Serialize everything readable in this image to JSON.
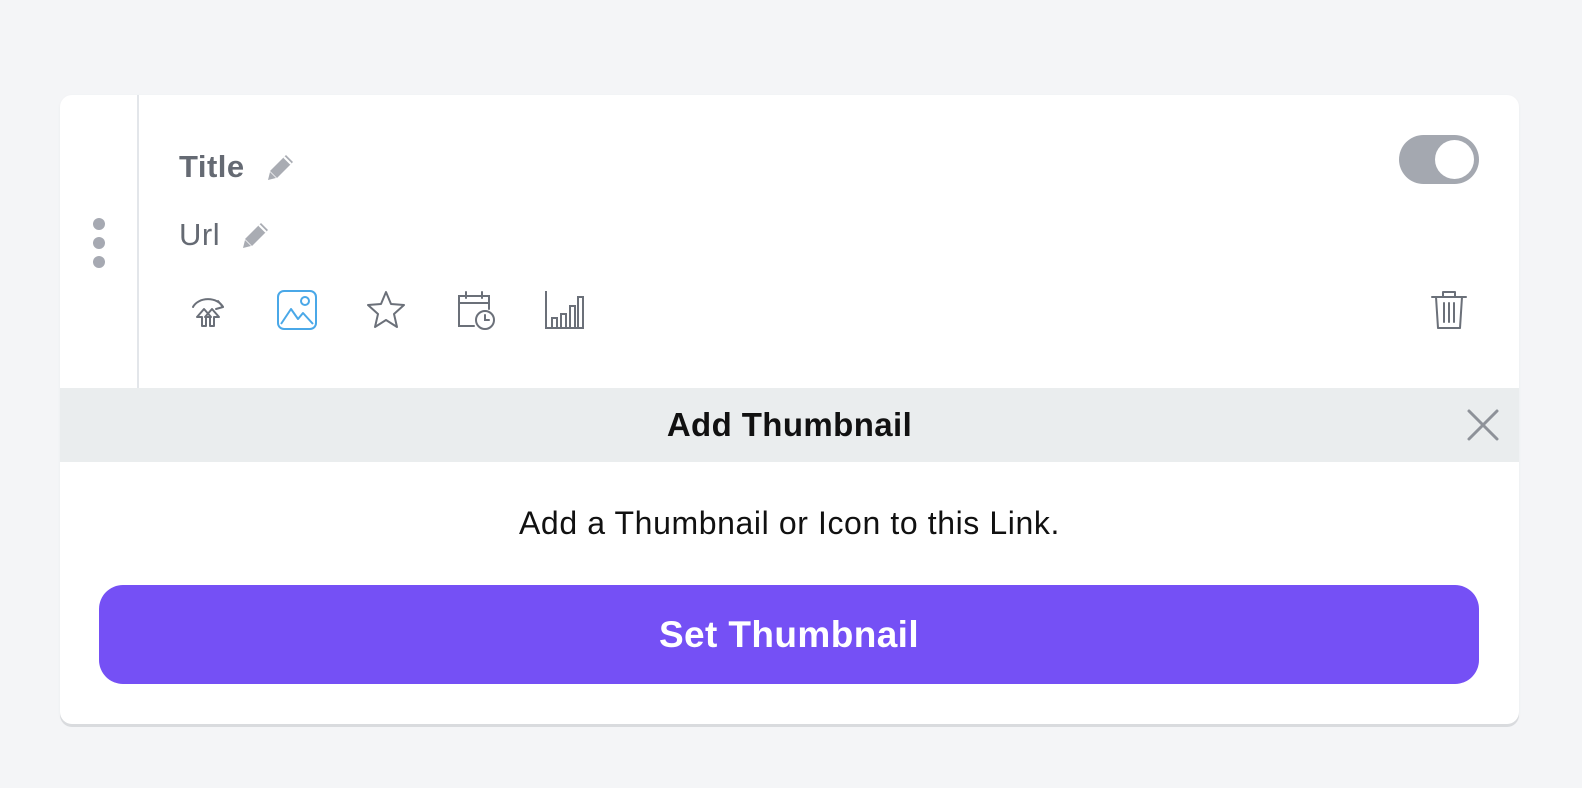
{
  "link": {
    "title": "Title",
    "url": "Url",
    "enabled": true
  },
  "toolbar": {
    "icons": [
      "redirect-icon",
      "thumbnail-icon",
      "star-icon",
      "schedule-icon",
      "analytics-icon",
      "trash-icon"
    ],
    "active_icon": "thumbnail-icon",
    "active_color": "#4aa8e8"
  },
  "panel": {
    "title": "Add Thumbnail",
    "description": "Add a Thumbnail or Icon to this Link.",
    "button_label": "Set Thumbnail"
  },
  "colors": {
    "accent": "#7550f5",
    "toggle_track": "#a4a8b0",
    "panel_header_bg": "#eaedee"
  }
}
